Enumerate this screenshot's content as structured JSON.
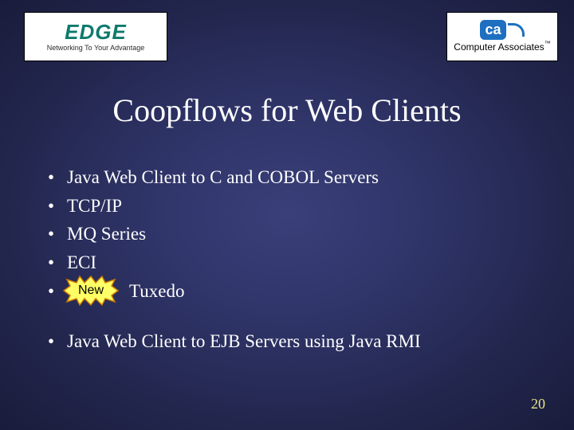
{
  "logos": {
    "edge": {
      "name": "EDGE",
      "tagline": "Networking To Your Advantage"
    },
    "ca": {
      "name": "Computer Associates",
      "mark": "ca",
      "tm": "™"
    }
  },
  "title": "Coopflows for Web Clients",
  "bullets_group1": [
    "Java Web Client to C and COBOL Servers",
    "TCP/IP",
    "MQ Series",
    "ECI"
  ],
  "new_badge": "New",
  "new_item": "Tuxedo",
  "bullets_group2": [
    "Java Web Client to EJB Servers using Java RMI"
  ],
  "page_number": "20"
}
